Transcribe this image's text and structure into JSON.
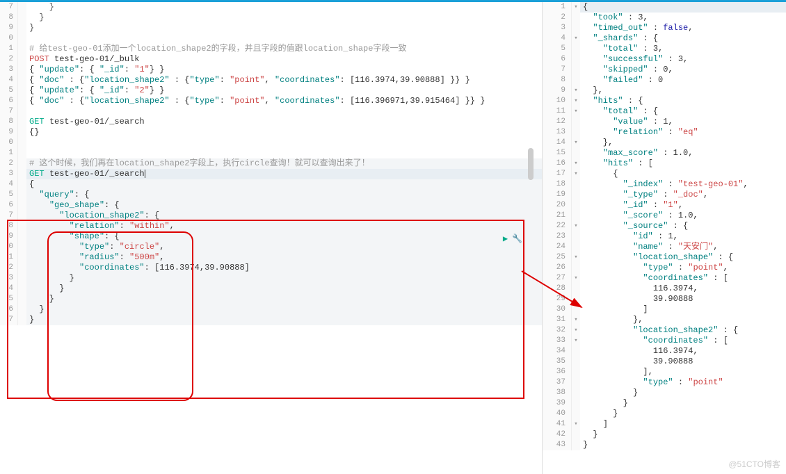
{
  "left": {
    "top_lines": [
      {
        "code": "    }"
      },
      {
        "code": "  }"
      },
      {
        "code": "}"
      },
      {
        "code": ""
      }
    ],
    "comment1": "# 给test-geo-01添加一个location_shape2的字段，并且字段的值跟location_shape字段一致",
    "post_line": {
      "method": "POST",
      "path": "test-geo-01/_bulk"
    },
    "bulk_lines": [
      "{ \"update\": { \"_id\": \"1\"} }",
      "{ \"doc\" : {\"location_shape2\" : {\"type\": \"point\", \"coordinates\": [116.3974,39.90888] }} }",
      "{ \"update\": { \"_id\": \"2\"} }",
      "{ \"doc\" : {\"location_shape2\" : {\"type\": \"point\", \"coordinates\": [116.396971,39.915464] }} }"
    ],
    "get1": {
      "method": "GET",
      "path": "test-geo-01/_search"
    },
    "get1_body": "{}",
    "comment2": "# 这个时候，我们再在location_shape2字段上，执行circle查询！就可以查询出来了！",
    "get2": {
      "method": "GET",
      "path": "test-geo-01/_search"
    },
    "query_block": [
      "{",
      "  \"query\": {",
      "    \"geo_shape\": {",
      "      \"location_shape2\": {",
      "        \"relation\": \"within\",",
      "        \"shape\": {",
      "          \"type\": \"circle\",",
      "          \"radius\": \"500m\",",
      "          \"coordinates\": [116.3974,39.90888]",
      "        }",
      "      }",
      "    }",
      "  }",
      "}"
    ]
  },
  "right": {
    "lines": [
      {
        "n": 1,
        "t": "{",
        "hl": true
      },
      {
        "n": 2,
        "t": "  \"took\" : 3,"
      },
      {
        "n": 3,
        "t": "  \"timed_out\" : false,"
      },
      {
        "n": 4,
        "t": "  \"_shards\" : {"
      },
      {
        "n": 5,
        "t": "    \"total\" : 3,"
      },
      {
        "n": 6,
        "t": "    \"successful\" : 3,"
      },
      {
        "n": 7,
        "t": "    \"skipped\" : 0,"
      },
      {
        "n": 8,
        "t": "    \"failed\" : 0"
      },
      {
        "n": 9,
        "t": "  },"
      },
      {
        "n": 10,
        "t": "  \"hits\" : {"
      },
      {
        "n": 11,
        "t": "    \"total\" : {"
      },
      {
        "n": 12,
        "t": "      \"value\" : 1,"
      },
      {
        "n": 13,
        "t": "      \"relation\" : \"eq\""
      },
      {
        "n": 14,
        "t": "    },"
      },
      {
        "n": 15,
        "t": "    \"max_score\" : 1.0,"
      },
      {
        "n": 16,
        "t": "    \"hits\" : ["
      },
      {
        "n": 17,
        "t": "      {"
      },
      {
        "n": 18,
        "t": "        \"_index\" : \"test-geo-01\","
      },
      {
        "n": 19,
        "t": "        \"_type\" : \"_doc\","
      },
      {
        "n": 20,
        "t": "        \"_id\" : \"1\","
      },
      {
        "n": 21,
        "t": "        \"_score\" : 1.0,"
      },
      {
        "n": 22,
        "t": "        \"_source\" : {"
      },
      {
        "n": 23,
        "t": "          \"id\" : 1,"
      },
      {
        "n": 24,
        "t": "          \"name\" : \"天安门\","
      },
      {
        "n": 25,
        "t": "          \"location_shape\" : {"
      },
      {
        "n": 26,
        "t": "            \"type\" : \"point\","
      },
      {
        "n": 27,
        "t": "            \"coordinates\" : ["
      },
      {
        "n": 28,
        "t": "              116.3974,"
      },
      {
        "n": 29,
        "t": "              39.90888"
      },
      {
        "n": 30,
        "t": "            ]"
      },
      {
        "n": 31,
        "t": "          },"
      },
      {
        "n": 32,
        "t": "          \"location_shape2\" : {"
      },
      {
        "n": 33,
        "t": "            \"coordinates\" : ["
      },
      {
        "n": 34,
        "t": "              116.3974,"
      },
      {
        "n": 35,
        "t": "              39.90888"
      },
      {
        "n": 36,
        "t": "            ],"
      },
      {
        "n": 37,
        "t": "            \"type\" : \"point\""
      },
      {
        "n": 38,
        "t": "          }"
      },
      {
        "n": 39,
        "t": "        }"
      },
      {
        "n": 40,
        "t": "      }"
      },
      {
        "n": 41,
        "t": "    ]"
      },
      {
        "n": 42,
        "t": "  }"
      },
      {
        "n": 43,
        "t": "}"
      }
    ]
  },
  "watermark": "@51CTO博客",
  "chart_data": {
    "type": "table",
    "title": "Elasticsearch geo_shape query result",
    "request": {
      "method": "GET",
      "url": "test-geo-01/_search",
      "body": {
        "query": {
          "geo_shape": {
            "location_shape2": {
              "relation": "within",
              "shape": {
                "type": "circle",
                "radius": "500m",
                "coordinates": [
                  116.3974,
                  39.90888
                ]
              }
            }
          }
        }
      }
    },
    "response": {
      "took": 3,
      "timed_out": false,
      "_shards": {
        "total": 3,
        "successful": 3,
        "skipped": 0,
        "failed": 0
      },
      "hits": {
        "total": {
          "value": 1,
          "relation": "eq"
        },
        "max_score": 1.0,
        "hits": [
          {
            "_index": "test-geo-01",
            "_type": "_doc",
            "_id": "1",
            "_score": 1.0,
            "_source": {
              "id": 1,
              "name": "天安门",
              "location_shape": {
                "type": "point",
                "coordinates": [
                  116.3974,
                  39.90888
                ]
              },
              "location_shape2": {
                "coordinates": [
                  116.3974,
                  39.90888
                ],
                "type": "point"
              }
            }
          }
        ]
      }
    }
  }
}
